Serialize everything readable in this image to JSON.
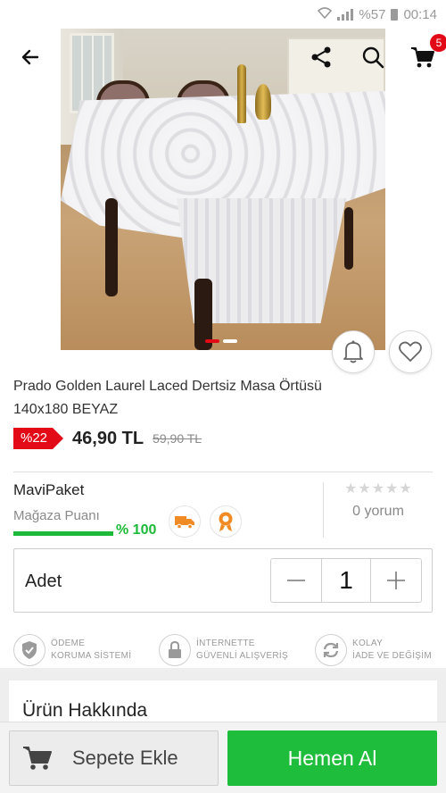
{
  "status_bar": {
    "battery": "%57",
    "time": "00:14"
  },
  "toolbar": {
    "cart_count": "5"
  },
  "product": {
    "title": "Prado Golden Laurel Laced Dertsiz Masa Örtüsü 140x180 BEYAZ",
    "discount": "%22",
    "price": "46,90 TL",
    "old_price": "59,90 TL"
  },
  "seller": {
    "name": "MaviPaket",
    "score_label": "Mağaza Puanı",
    "score_value": "% 100",
    "score_fraction": 1.0,
    "rating_stars": 0,
    "reviews": "0 yorum"
  },
  "quantity": {
    "label": "Adet",
    "value": "1"
  },
  "guarantees": [
    {
      "line1": "ÖDEME",
      "line2": "KORUMA SİSTEMİ"
    },
    {
      "line1": "İNTERNETTE",
      "line2": "GÜVENLİ ALIŞVERİŞ"
    },
    {
      "line1": "KOLAY",
      "line2": "İADE VE DEĞİŞİM"
    }
  ],
  "about": {
    "title": "Ürün Hakkında"
  },
  "actions": {
    "add_to_cart": "Sepete Ekle",
    "buy_now": "Hemen Al"
  },
  "colors": {
    "accent_red": "#e30a17",
    "accent_green": "#1ebd3c"
  }
}
